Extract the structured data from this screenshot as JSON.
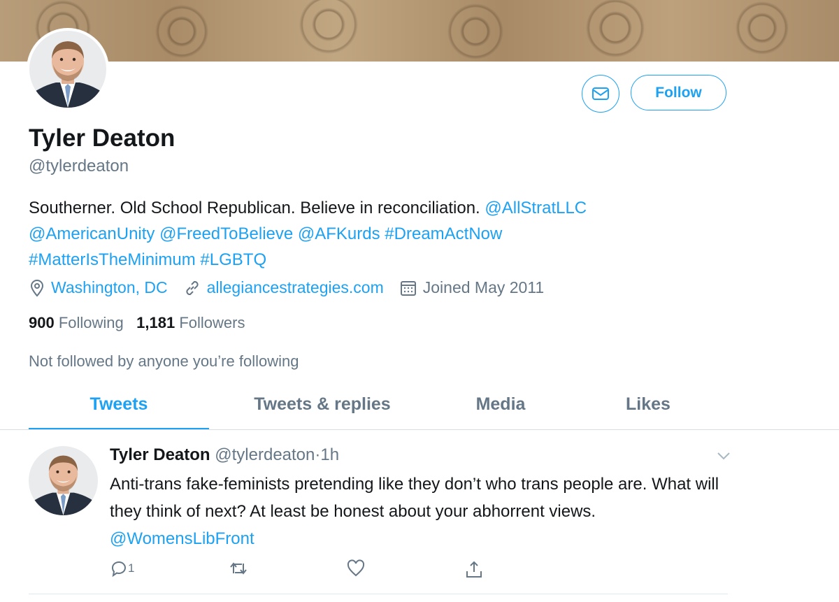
{
  "profile": {
    "name": "Tyler Deaton",
    "handle": "@tylerdeaton",
    "bio_text": "Southerner. Old School Republican. Believe in reconciliation.",
    "bio_mentions": [
      "@AllStratLLC",
      "@AmericanUnity",
      "@FreedToBelieve",
      "@AFKurds",
      "#DreamActNow",
      "#MatterIsTheMinimum",
      "#LGBTQ"
    ],
    "location": "Washington, DC",
    "website": "allegiancestrategies.com",
    "joined": "Joined May 2011",
    "following_count": "900",
    "following_label": "Following",
    "followers_count": "1,181",
    "followers_label": "Followers",
    "not_followed": "Not followed by anyone you’re following"
  },
  "actions": {
    "follow_label": "Follow",
    "message_icon": "envelope-icon"
  },
  "tabs": [
    "Tweets",
    "Tweets & replies",
    "Media",
    "Likes"
  ],
  "active_tab": "Tweets",
  "tweet": {
    "name": "Tyler Deaton",
    "handle": "@tylerdeaton",
    "separator": "·",
    "time": "1h",
    "text": "Anti-trans fake-feminists pretending like they don’t who trans people are. What will they think of next? At least be honest about your abhorrent views.",
    "mention": "@WomensLibFront",
    "reply_count": "1"
  },
  "colors": {
    "accent": "#1da1f2",
    "secondary_text": "#657786",
    "primary_text": "#14171a"
  }
}
